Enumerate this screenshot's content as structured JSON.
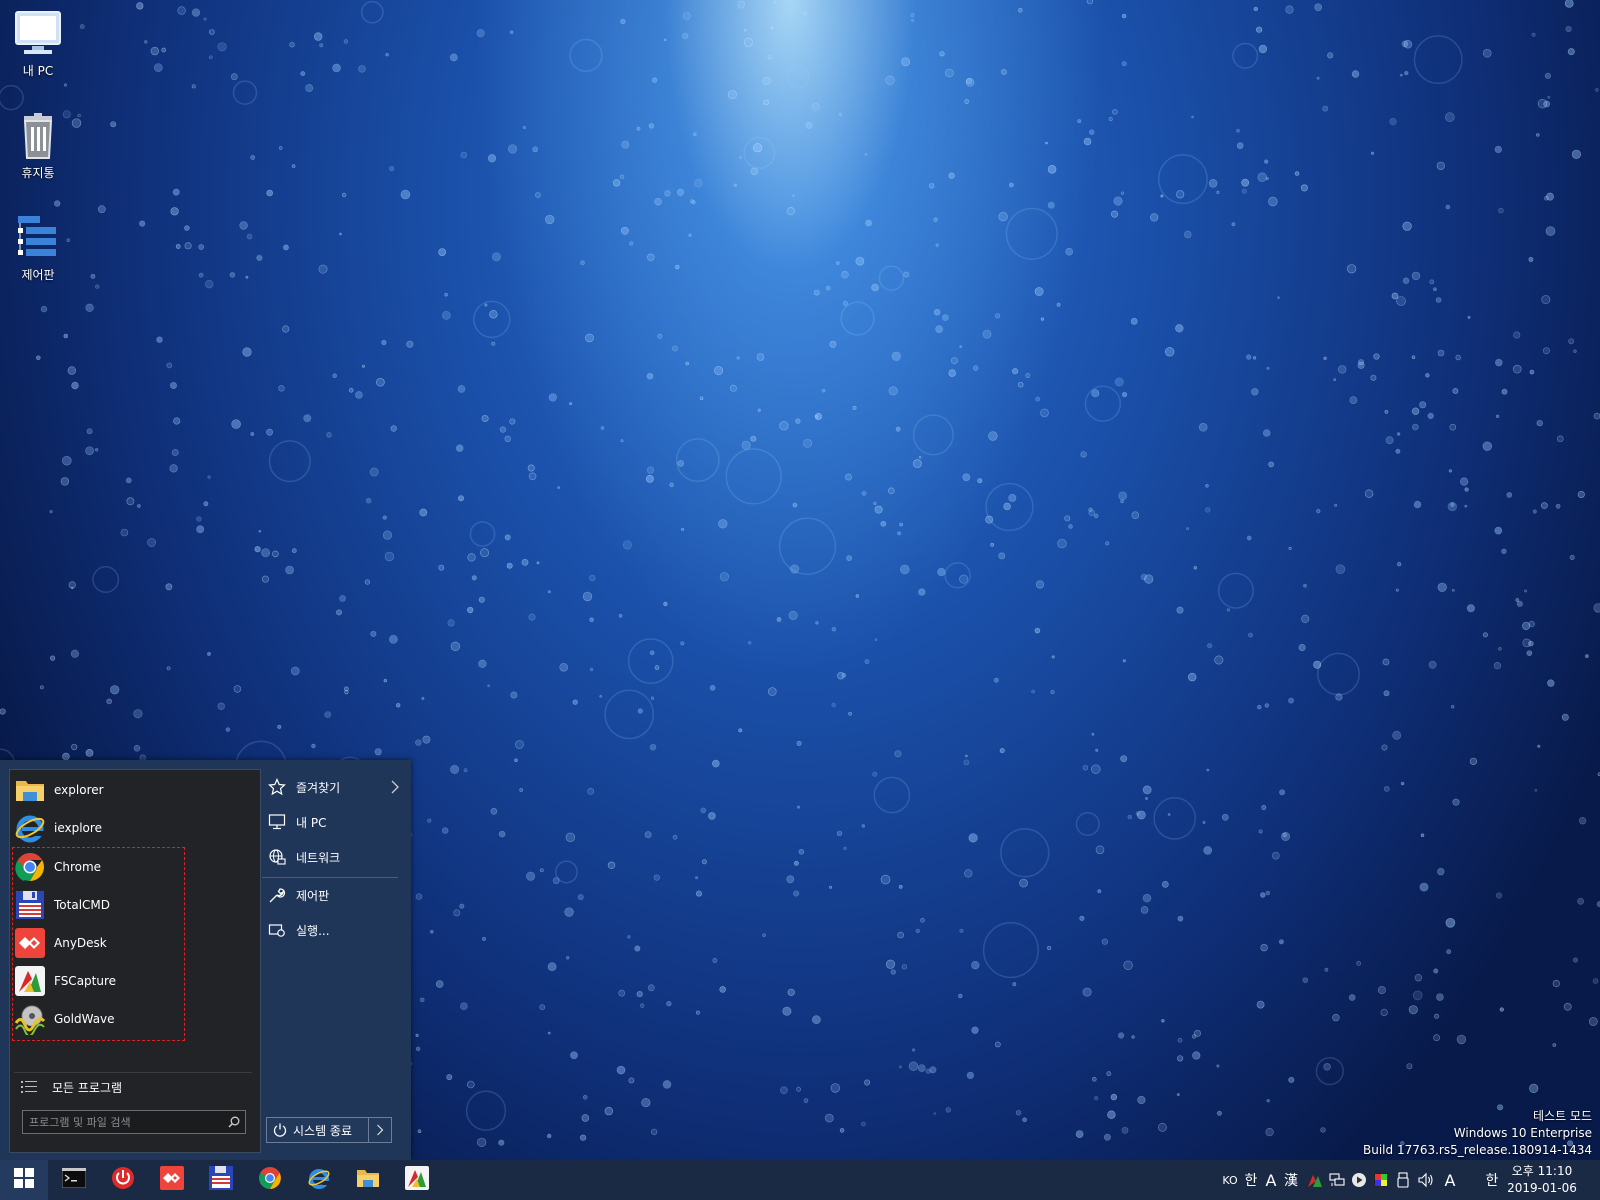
{
  "desktop": {
    "icons": [
      {
        "label": "내 PC",
        "icon": "monitor-icon"
      },
      {
        "label": "휴지통",
        "icon": "recycle-bin-icon"
      },
      {
        "label": "제어판",
        "icon": "control-panel-icon"
      }
    ],
    "watermark": {
      "line1": "테스트 모드",
      "line2": "Windows 10 Enterprise",
      "line3": "Build 17763.rs5_release.180914-1434"
    }
  },
  "start_menu": {
    "apps": [
      {
        "label": "explorer",
        "icon": "folder-icon"
      },
      {
        "label": "iexplore",
        "icon": "internet-explorer-icon"
      },
      {
        "label": "Chrome",
        "icon": "chrome-icon"
      },
      {
        "label": "TotalCMD",
        "icon": "floppy-disk-icon"
      },
      {
        "label": "AnyDesk",
        "icon": "anydesk-icon"
      },
      {
        "label": "FSCapture",
        "icon": "fscapture-icon"
      },
      {
        "label": "GoldWave",
        "icon": "goldwave-icon"
      }
    ],
    "all_programs": "모든 프로그램",
    "search_placeholder": "프로그램 및 파일 검색",
    "right_items": [
      {
        "label": "즐겨찾기",
        "icon": "star-icon",
        "submenu": true
      },
      {
        "label": "내 PC",
        "icon": "computer-icon"
      },
      {
        "label": "네트워크",
        "icon": "network-icon"
      },
      {
        "label": "제어판",
        "icon": "wrench-icon"
      },
      {
        "label": "실행...",
        "icon": "run-icon"
      }
    ],
    "shutdown_label": "시스템 종료",
    "highlight_color": "#e02020"
  },
  "taskbar": {
    "pinned": [
      {
        "name": "cmd",
        "icon": "cmd-icon"
      },
      {
        "name": "power",
        "icon": "power-icon"
      },
      {
        "name": "anydesk",
        "icon": "anydesk-icon"
      },
      {
        "name": "totalcmd",
        "icon": "floppy-disk-icon"
      },
      {
        "name": "chrome",
        "icon": "chrome-icon"
      },
      {
        "name": "iexplore",
        "icon": "internet-explorer-icon"
      },
      {
        "name": "explorer",
        "icon": "folder-icon"
      },
      {
        "name": "fscapture",
        "icon": "fscapture-icon"
      }
    ],
    "tray": {
      "lang": "KO",
      "ime_han": "한",
      "ime_a": "A",
      "ime_hanja": "漢",
      "ime_a2": "A",
      "ime_han2": "한"
    },
    "clock": {
      "time": "오후 11:10",
      "date": "2019-01-06"
    }
  },
  "colors": {
    "taskbar": "#1a2a44",
    "start_menu_bg": "#1f3658",
    "left_panel_bg": "#222326"
  }
}
